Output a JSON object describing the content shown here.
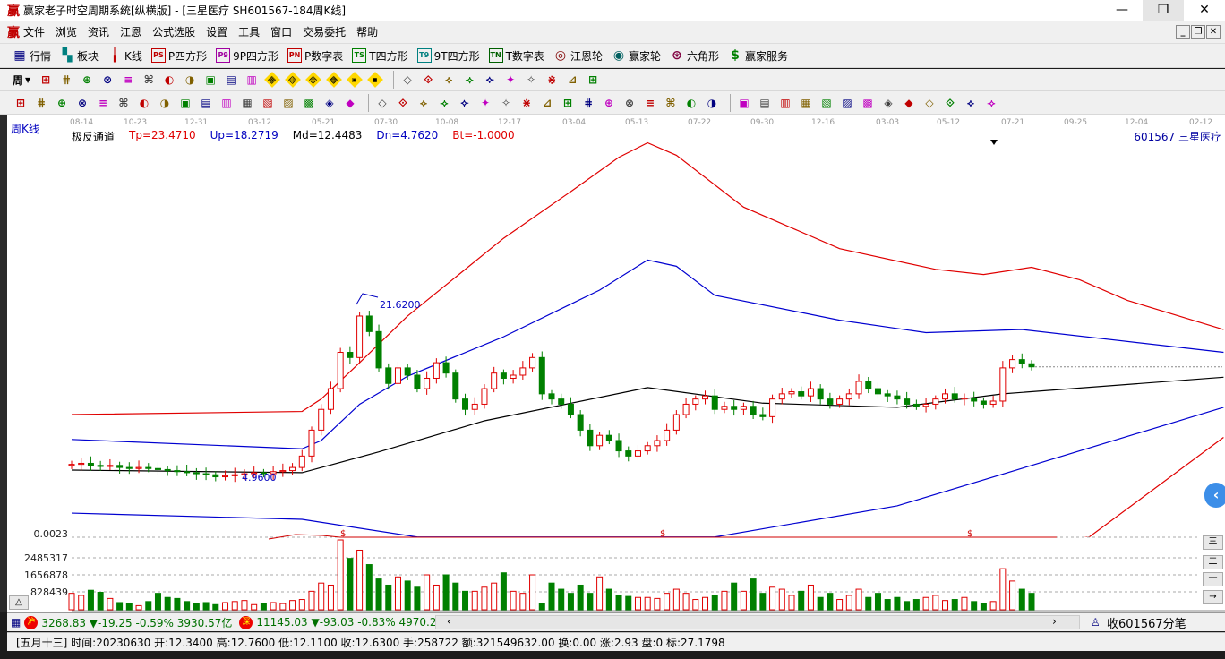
{
  "window": {
    "title": "赢家老子时空周期系统[纵横版] - [三星医疗  SH601567-184周K线]",
    "logo": "赢"
  },
  "menu": [
    "文件",
    "浏览",
    "资讯",
    "江恩",
    "公式选股",
    "设置",
    "工具",
    "窗口",
    "交易委托",
    "帮助"
  ],
  "toolbar1": [
    {
      "icon": "grid-icon",
      "glyph": "▦",
      "label": "行情",
      "color": "#000080"
    },
    {
      "icon": "blocks-icon",
      "glyph": "▚",
      "label": "板块",
      "color": "#008080"
    },
    {
      "icon": "kline-icon",
      "glyph": "╽",
      "label": "K线",
      "color": "#c00000"
    },
    {
      "icon": "ps-icon",
      "glyph": "PS",
      "label": "P四方形",
      "color": "#c00000"
    },
    {
      "icon": "p9-icon",
      "glyph": "P9",
      "label": "9P四方形",
      "color": "#a000a0"
    },
    {
      "icon": "pn-icon",
      "glyph": "PN",
      "label": "P数字表",
      "color": "#c00000"
    },
    {
      "icon": "ts-icon",
      "glyph": "TS",
      "label": "T四方形",
      "color": "#008000"
    },
    {
      "icon": "t9-icon",
      "glyph": "T9",
      "label": "9T四方形",
      "color": "#008080"
    },
    {
      "icon": "tn-icon",
      "glyph": "TN",
      "label": "T数字表",
      "color": "#006000"
    },
    {
      "icon": "gann-wheel-icon",
      "glyph": "◎",
      "label": "江恩轮",
      "color": "#800000"
    },
    {
      "icon": "winner-wheel-icon",
      "glyph": "◉",
      "label": "赢家轮",
      "color": "#006060"
    },
    {
      "icon": "hexagon-icon",
      "glyph": "⊛",
      "label": "六角形",
      "color": "#800040"
    },
    {
      "icon": "dollar-icon",
      "glyph": "$",
      "label": "赢家服务",
      "color": "#008000"
    }
  ],
  "toolbar2": {
    "period": "周",
    "icons": [
      "fold-icon",
      "doc-icon",
      "bars3-icon",
      "bars9-icon",
      "candle-icon",
      "extreme-icon",
      "color-icon",
      "first-icon",
      "last-icon",
      "left-icon",
      "right-icon",
      "arrow-left-icon",
      "arrow-right-icon",
      "arrow-h-icon",
      "arrow-in-icon",
      "arrow-x-icon",
      "arrow-v-icon",
      "hand-icon",
      "cross-icon",
      "draw-icon",
      "node-icon",
      "pattern-icon",
      "calendar-icon",
      "calc-icon",
      "report-icon",
      "save-icon",
      "network-icon"
    ]
  },
  "toolbar3": {
    "icons": [
      "pen-icon",
      "lines-icon",
      "gold1-icon",
      "gold2-icon",
      "fib-icon",
      "spiral-icon",
      "fan-icon",
      "circle-icon",
      "parallel-icon",
      "n2-icon",
      "angle-icon",
      "target-icon",
      "web-icon",
      "square-icon",
      "gann-line-icon",
      "time-icon",
      "winner-icon",
      "grid-line-icon",
      "range-icon",
      "box-icon",
      "fan2-icon",
      "square2-icon",
      "square3-icon",
      "angle2-icon",
      "wave-icon",
      "grid2-icon",
      "grid3-icon",
      "slash-icon",
      "table-icon",
      "percent2-icon",
      "percent-icon",
      "pct-line-icon",
      "gold-coin-icon",
      "gold-line-icon",
      "rocket-icon",
      "ab-icon",
      "gold3-icon",
      "j-icon",
      "f-icon",
      "gold4-icon",
      "god-icon",
      "win-icon",
      "four-icon",
      "grid-yellow-icon",
      "chart-line-icon",
      "yinyang-icon",
      "infinity-icon"
    ]
  },
  "chart": {
    "period_label": "周K线",
    "indicator": {
      "name": "极反通道",
      "tp": "Tp=23.4710",
      "up": "Up=18.2719",
      "md": "Md=12.4483",
      "dn": "Dn=4.7620",
      "bt": "Bt=-1.0000"
    },
    "stock": "601567  三星医疗",
    "dates": [
      "08-14",
      "10-23",
      "12-31",
      "03-12",
      "05-21",
      "07-30",
      "10-08",
      "12-17",
      "03-04",
      "05-13",
      "07-22",
      "09-30",
      "12-16",
      "03-03",
      "05-12",
      "07-21",
      "09-25",
      "12-04",
      "02-12"
    ],
    "high_label": "21.6200",
    "low_label": "4.9600",
    "vol_labels": [
      "0.0023",
      "2485317",
      "1656878",
      "828439"
    ],
    "side_buttons": [
      "三",
      "二",
      "一",
      "→"
    ],
    "toggle": "△",
    "marker": "$"
  },
  "chart_data": {
    "type": "candlestick",
    "closes": [
      6.2,
      6.3,
      6.1,
      6.0,
      6.1,
      5.9,
      5.8,
      5.9,
      5.8,
      5.7,
      5.6,
      5.5,
      5.4,
      5.3,
      5.2,
      5.0,
      5.1,
      5.2,
      5.3,
      5.4,
      5.3,
      5.5,
      5.6,
      5.9,
      7.0,
      9.5,
      11.5,
      13.5,
      17.0,
      16.5,
      20.5,
      19.0,
      15.5,
      14.0,
      15.5,
      14.8,
      13.5,
      14.5,
      16.0,
      15.0,
      12.5,
      11.5,
      12.0,
      13.5,
      15.0,
      14.5,
      14.8,
      15.5,
      16.5,
      13.0,
      12.5,
      12.0,
      11.0,
      9.5,
      8.0,
      9.0,
      8.5,
      7.5,
      7.0,
      7.5,
      8.0,
      8.5,
      9.5,
      11.0,
      12.0,
      12.5,
      12.8,
      11.5,
      11.8,
      11.5,
      11.8,
      11.0,
      10.8,
      12.5,
      13.0,
      13.2,
      12.8,
      13.5,
      12.5,
      12.0,
      12.5,
      13.0,
      14.2,
      13.5,
      13.0,
      12.8,
      12.5,
      12.0,
      11.8,
      12.0,
      12.5,
      13.0,
      12.5,
      12.6,
      12.3,
      12.0,
      12.3,
      15.5,
      16.3,
      15.9,
      15.6
    ],
    "volumes": [
      800000,
      700000,
      950000,
      850000,
      550000,
      350000,
      300000,
      200000,
      400000,
      800000,
      600000,
      550000,
      400000,
      300000,
      350000,
      250000,
      350000,
      400000,
      450000,
      250000,
      300000,
      350000,
      300000,
      450000,
      500000,
      900000,
      1300000,
      1200000,
      3400000,
      2500000,
      2900000,
      2200000,
      1500000,
      1200000,
      1600000,
      1400000,
      1100000,
      1700000,
      1200000,
      1700000,
      1300000,
      900000,
      900000,
      1100000,
      1300000,
      1800000,
      900000,
      800000,
      1700000,
      300000,
      1300000,
      1000000,
      800000,
      1200000,
      800000,
      1600000,
      1000000,
      700000,
      650000,
      600000,
      600000,
      550000,
      800000,
      1000000,
      800000,
      500000,
      600000,
      700000,
      900000,
      1300000,
      900000,
      1500000,
      800000,
      1100000,
      1000000,
      700000,
      900000,
      1200000,
      600000,
      800000,
      500000,
      700000,
      1000000,
      600000,
      800000,
      500000,
      600000,
      400000,
      500000,
      600000,
      700000,
      450000,
      500000,
      600000,
      400000,
      300000,
      400000,
      2000000,
      1400000,
      1000000,
      800000,
      300000
    ],
    "channels": [
      {
        "name": "Tp",
        "color": "#e00000",
        "points": [
          [
            0,
            11.0
          ],
          [
            24,
            11.3
          ],
          [
            26,
            12.5
          ],
          [
            30,
            16
          ],
          [
            35,
            20.5
          ],
          [
            45,
            28
          ],
          [
            52,
            32.5
          ],
          [
            57,
            35.8
          ],
          [
            60,
            37.2
          ],
          [
            63,
            36
          ],
          [
            70,
            31
          ],
          [
            80,
            27
          ],
          [
            90,
            25
          ],
          [
            95,
            24.5
          ],
          [
            100,
            25.2
          ],
          [
            105,
            24
          ],
          [
            110,
            22
          ],
          [
            120,
            19.2
          ]
        ]
      },
      {
        "name": "Up",
        "color": "#0000d0",
        "points": [
          [
            0,
            8.6
          ],
          [
            24,
            7.7
          ],
          [
            26,
            8.5
          ],
          [
            30,
            12
          ],
          [
            35,
            14.7
          ],
          [
            45,
            18.5
          ],
          [
            55,
            23
          ],
          [
            60,
            25.9
          ],
          [
            63,
            25.3
          ],
          [
            67,
            22.5
          ],
          [
            80,
            20.1
          ],
          [
            89,
            18.9
          ],
          [
            99,
            19.2
          ],
          [
            120,
            17.0
          ]
        ]
      },
      {
        "name": "Md",
        "color": "#000000",
        "points": [
          [
            0,
            5.65
          ],
          [
            24,
            5.4
          ],
          [
            32,
            7.4
          ],
          [
            43,
            10.4
          ],
          [
            60,
            13.6
          ],
          [
            72,
            12.1
          ],
          [
            86,
            11.7
          ],
          [
            97,
            13
          ],
          [
            120,
            14.6
          ]
        ]
      },
      {
        "name": "Dn",
        "color": "#0000d0",
        "points": [
          [
            0,
            1.5
          ],
          [
            24,
            0.9
          ],
          [
            36,
            -0.8
          ],
          [
            67,
            -0.8
          ],
          [
            86,
            2.2
          ],
          [
            100,
            6.1
          ],
          [
            120,
            11.7
          ]
        ]
      },
      {
        "name": "Bt",
        "color": "#e00000",
        "points": [
          [
            0,
            -5
          ],
          [
            103,
            -1.2
          ],
          [
            106,
            -0.8
          ],
          [
            120,
            8.8
          ]
        ]
      }
    ],
    "high": 21.62,
    "low": 4.96,
    "last": 15.6
  },
  "ticker": {
    "sh_icon": "沪",
    "sh": "3268.83 ▼-19.25 -0.59% 3930.57亿",
    "sz_icon": "深",
    "sz": "11145.03 ▼-93.03 -0.83% 4970.20",
    "right": "收601567分笔"
  },
  "status": "[五月十三] 时间:20230630 开:12.3400 高:12.7600 低:12.1100 收:12.6300 手:258722 额:321549632.00 换:0.00 涨:2.93 盘:0 标:27.1798"
}
